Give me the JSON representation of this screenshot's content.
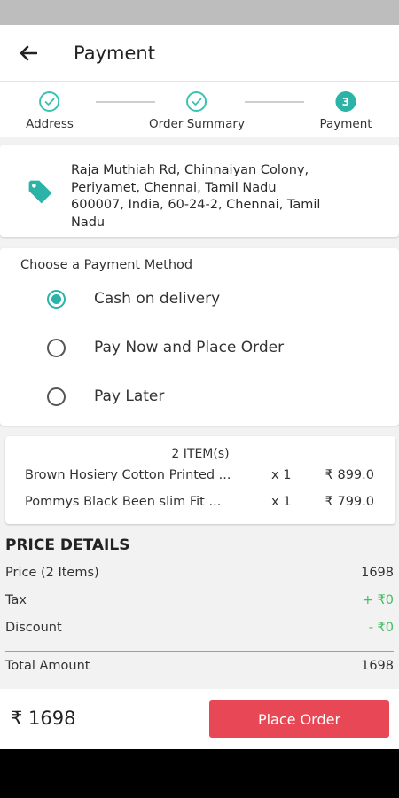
{
  "header": {
    "title": "Payment"
  },
  "stepper": {
    "steps": [
      {
        "label": "Address",
        "state": "done"
      },
      {
        "label": "Order Summary",
        "state": "done"
      },
      {
        "label": "Payment",
        "number": "3",
        "state": "active"
      }
    ]
  },
  "address": {
    "icon": "tag-icon",
    "lines": [
      "Raja Muthiah Rd, Chinnaiyan Colony,",
      "Periyamet, Chennai, Tamil Nadu",
      "600007, India, 60-24-2, Chennai, Tamil",
      "Nadu"
    ]
  },
  "payment": {
    "heading": "Choose a Payment Method",
    "options": [
      {
        "label": "Cash on delivery",
        "selected": true
      },
      {
        "label": "Pay Now and Place Order",
        "selected": false
      },
      {
        "label": "Pay Later",
        "selected": false
      }
    ]
  },
  "items": {
    "count_label": "2 ITEM(s)",
    "list": [
      {
        "name": "Brown Hosiery Cotton Printed ...",
        "qty": "x 1",
        "price": "₹ 899.0"
      },
      {
        "name": "Pommys Black Been slim Fit ...",
        "qty": "x 1",
        "price": "₹ 799.0"
      }
    ]
  },
  "price_details": {
    "heading": "PRICE DETAILS",
    "rows": [
      {
        "label": "Price (2 Items)",
        "value": "1698"
      },
      {
        "label": "Tax",
        "value": "+ ₹0"
      },
      {
        "label": "Discount",
        "value": "- ₹0"
      }
    ],
    "total_label": "Total Amount",
    "total_value": "1698"
  },
  "footer": {
    "amount": "₹ 1698",
    "button_label": "Place Order"
  },
  "colors": {
    "accent": "#2ab3a6",
    "button": "#e84855",
    "green": "#3ebf5a"
  }
}
